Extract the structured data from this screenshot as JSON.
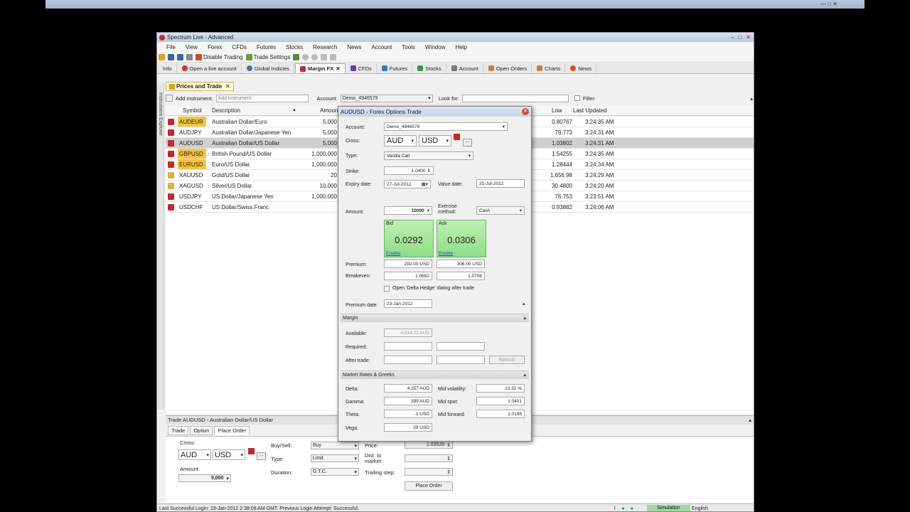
{
  "outer": {
    "controls": "—  □  ✕"
  },
  "window": {
    "title": "Spectrum Live - Advanced",
    "min": "–",
    "max": "□",
    "close": "✕"
  },
  "menu": [
    "File",
    "View",
    "Forex",
    "CFDs",
    "Futures",
    "Stocks",
    "Research",
    "News",
    "Account",
    "Tools",
    "Window",
    "Help"
  ],
  "toolbar": {
    "disable_trading": "Disable Trading",
    "trade_settings": "Trade Settings"
  },
  "tabs": [
    {
      "label": "Info",
      "color": ""
    },
    {
      "label": "Open a live account",
      "color": "#d32f2f"
    },
    {
      "label": "Global Indicies",
      "color": "#4a6fa5"
    },
    {
      "label": "Margin FX",
      "color": "#c62828"
    },
    {
      "label": "CFDs",
      "color": "#6b3fa0"
    },
    {
      "label": "Futures",
      "color": "#2e7bc4"
    },
    {
      "label": "Stocks",
      "color": "#2e9b4a"
    },
    {
      "label": "Account",
      "color": "#777777"
    },
    {
      "label": "Open Orders",
      "color": "#c0862b"
    },
    {
      "label": "Charts",
      "color": "#c0862b"
    },
    {
      "label": "News",
      "color": "#d35400"
    }
  ],
  "side_panel": "Instrument Explorer",
  "subtab": {
    "label": "Prices and Trade",
    "close": "✕"
  },
  "filter": {
    "add_instrument_label": "Add instrument:",
    "add_instrument_placeholder": "Add instrument",
    "account_label": "Account:",
    "account_value": "Demo_4946579",
    "look_for_label": "Look for:",
    "filter_label": "Filter"
  },
  "grid": {
    "headers": {
      "symbol": "Symbol",
      "description": "Description",
      "amount": "Amount",
      "low": "Low",
      "last_updated": "Last Updated"
    },
    "rows": [
      {
        "symbol": "AUDEUR",
        "description": "Australian Dollar/Euro",
        "amount": "5,000",
        "low": "0.80767",
        "updated": "3:24:35 AM",
        "hl": true,
        "metal": false,
        "sel": false
      },
      {
        "symbol": "AUDJPY",
        "description": "Australian Dollar/Japanese Yen",
        "amount": "5,000",
        "low": "79.773",
        "updated": "3:24:31 AM",
        "hl": false,
        "metal": false,
        "sel": false
      },
      {
        "symbol": "AUDUSD",
        "description": "Australian Dollar/US Dollar",
        "amount": "5,000",
        "low": "1.03802",
        "updated": "3:24:31 AM",
        "hl": false,
        "metal": false,
        "sel": true
      },
      {
        "symbol": "GBPUSD",
        "description": "British Pound/US Dollar",
        "amount": "1,000,000",
        "low": "1.54255",
        "updated": "3:24:35 AM",
        "hl": true,
        "metal": false,
        "sel": false
      },
      {
        "symbol": "EURUSD",
        "description": "Euro/US Dollar",
        "amount": "1,000,000",
        "low": "1.28444",
        "updated": "3:24:34 AM",
        "hl": true,
        "metal": false,
        "sel": false
      },
      {
        "symbol": "XAUUSD",
        "description": "Gold/US Dollar",
        "amount": "20",
        "low": "1,656.98",
        "updated": "3:24:29 AM",
        "hl": false,
        "metal": true,
        "sel": false
      },
      {
        "symbol": "XAGUSD",
        "description": "Silver/US Dollar",
        "amount": "10,000",
        "low": "30.4800",
        "updated": "3:24:20 AM",
        "hl": false,
        "metal": true,
        "sel": false
      },
      {
        "symbol": "USDJPY",
        "description": "US Dollar/Japanese Yen",
        "amount": "1,000,000",
        "low": "76.753",
        "updated": "3:23:51 AM",
        "hl": false,
        "metal": false,
        "sel": false
      },
      {
        "symbol": "USDCHF",
        "description": "US Dollar/Swiss Franc",
        "amount": "",
        "low": "0.93882",
        "updated": "3:24:06 AM",
        "hl": false,
        "metal": false,
        "sel": false
      }
    ]
  },
  "bottom": {
    "title": "Trade AUDUSD - Australian Dollar/US Dollar",
    "tabs": [
      "Trade",
      "Option",
      "Place Order"
    ],
    "cross_label": "Cross:",
    "cross_from": "AUD",
    "cross_to": "USD",
    "amount_label": "Amount:",
    "amount_value": "5,000",
    "buysell_label": "Buy/Sell:",
    "buysell_value": "Buy",
    "type_label": "Type:",
    "type_value": "Limit",
    "duration_label": "Duration:",
    "duration_value": "G.T.C.",
    "price_label": "Price:",
    "price_value": "1.03520",
    "dist_label": "Dist. to market:",
    "trailing_label": "Trailing step:",
    "place_order": "Place Order"
  },
  "status": {
    "text": "Last Successful Login: 19-Jan-2012 2:38:08 AM GMT. Previous Login Attempt: Successful.",
    "simulation": "Simulation",
    "language": "English"
  },
  "dialog": {
    "title": "AUDUSD - Forex Options Trade",
    "close": "✕",
    "account_label": "Account:",
    "account_value": "Demo_4946579",
    "cross_label": "Cross:",
    "cross_from": "AUD",
    "cross_to": "USD",
    "type_label": "Type:",
    "type_value": "Vanilla Call",
    "strike_label": "Strike:",
    "strike_value": "1.0400",
    "expiry_label": "Expiry date:",
    "expiry_value": "27-Jul-2012",
    "value_date_label": "Value date:",
    "value_date_value": "31-Jul-2012",
    "amount_label": "Amount:",
    "amount_value": "10000",
    "exercise_label": "Exercise method:",
    "exercise_value": "Cash",
    "bid_label": "Bid",
    "bid_value": "0.0292",
    "ask_label": "Ask",
    "ask_value": "0.0306",
    "enable": "Enable",
    "premium_label": "Premium:",
    "premium_bid": "292.00 USD",
    "premium_ask": "306.00 USD",
    "breakeven_label": "Breakeven:",
    "breakeven_bid": "1.0692",
    "breakeven_ask": "1.0706",
    "delta_hedge_label": "Open 'Delta Hedge' dialog after trade",
    "premium_date_label": "Premium date:",
    "premium_date_value": "23-Jan-2012",
    "margin_section": "Margin",
    "available_label": "Available:",
    "available_value": "4,914.22 AUD",
    "required_label": "Required:",
    "after_trade_label": "After trade:",
    "refresh": "Refresh",
    "greeks_section": "Market Rates & Greeks",
    "delta_label": "Delta:",
    "delta_value": "4,257 AUD",
    "gamma_label": "Gamma:",
    "gamma_value": "399 AUD",
    "theta_label": "Theta:",
    "theta_value": "-1 USD",
    "vega_label": "Vega:",
    "vega_value": "29 USD",
    "mid_vol_label": "Mid volatility:",
    "mid_vol_value": "13.32 %",
    "mid_spot_label": "Mid spot:",
    "mid_spot_value": "1.0401",
    "mid_fwd_label": "Mid forward:",
    "mid_fwd_value": "1.0198"
  }
}
